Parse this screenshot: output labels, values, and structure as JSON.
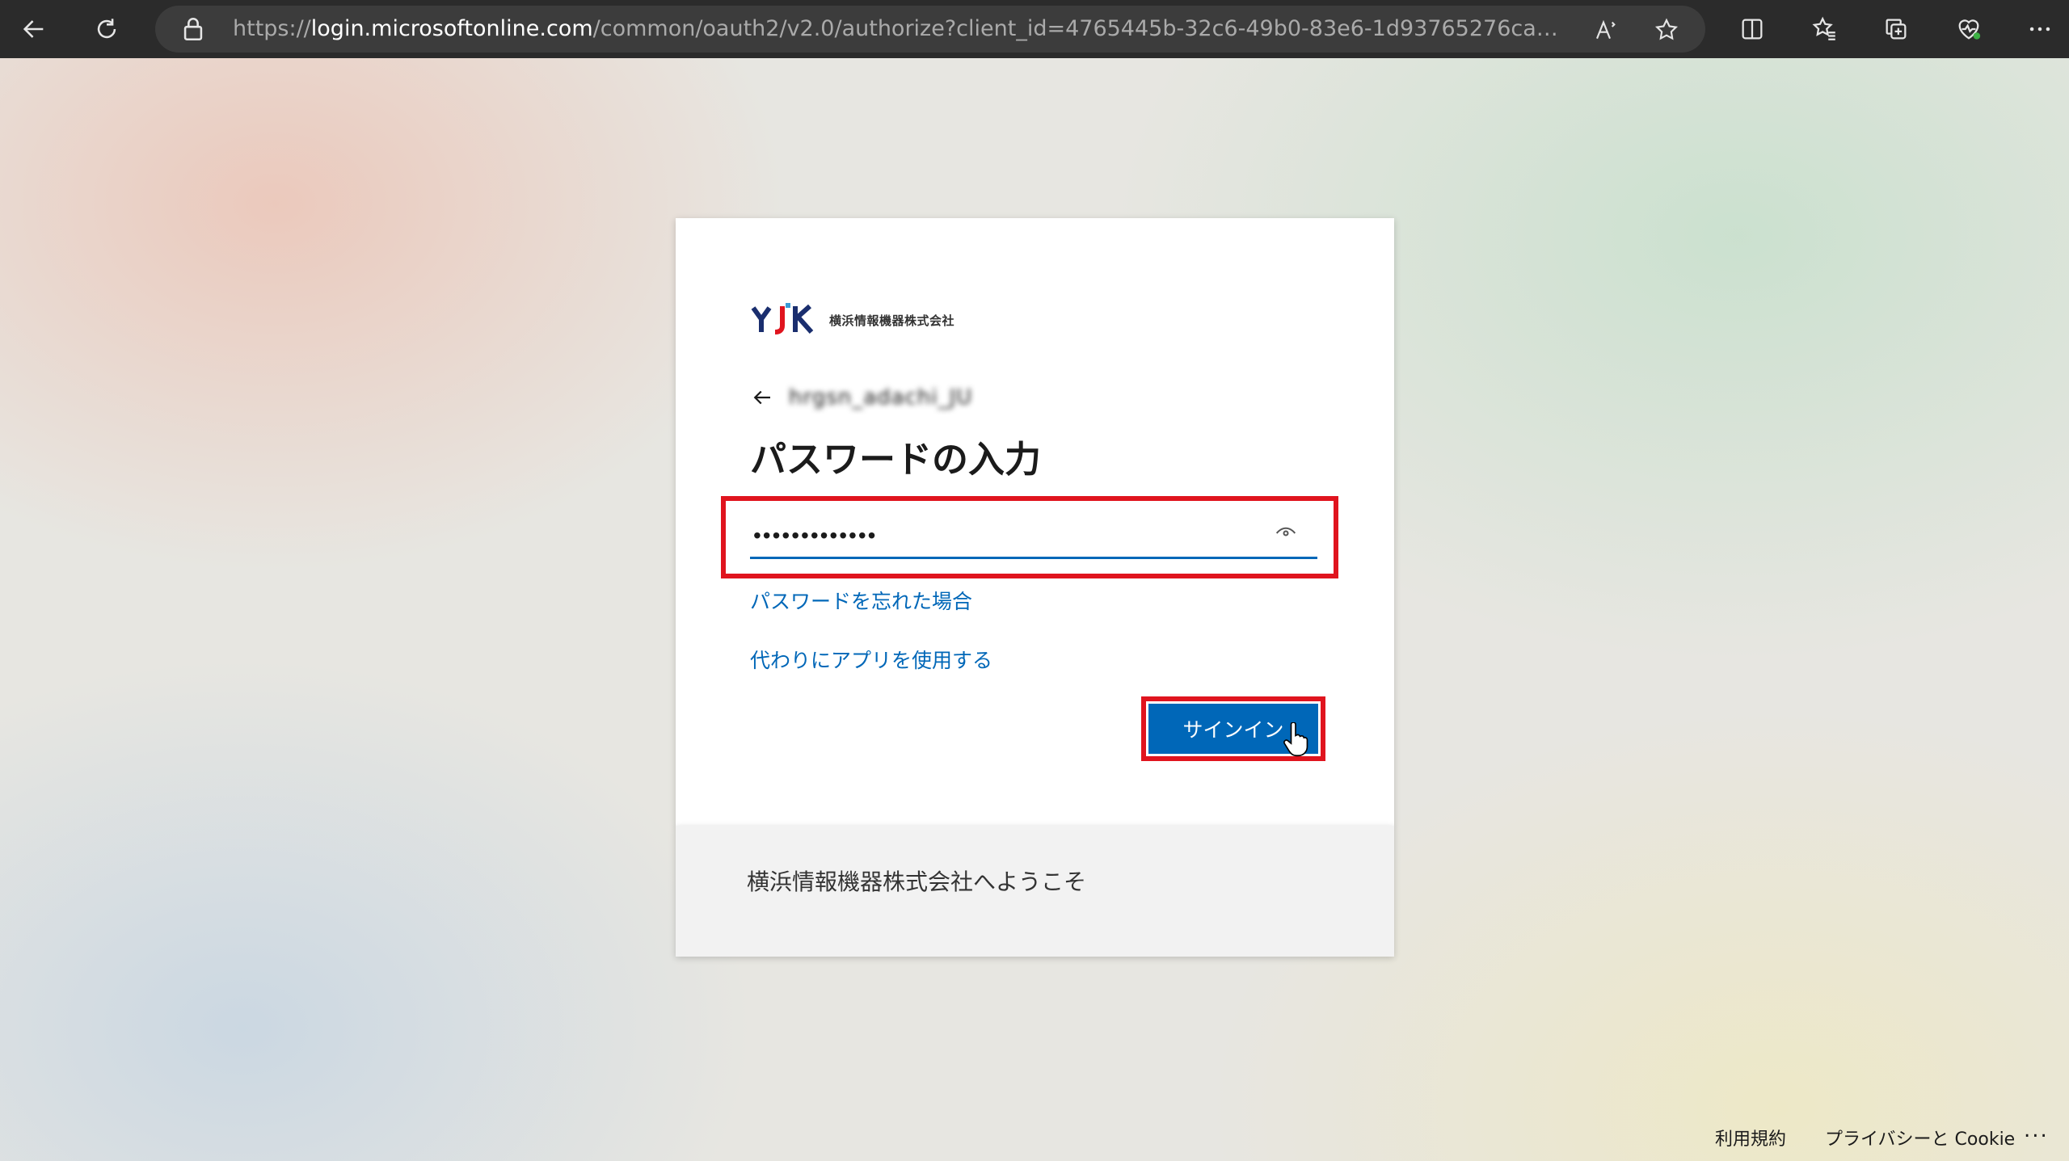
{
  "browser": {
    "url_prefix": "https://",
    "url_host": "login.microsoftonline.com",
    "url_rest": "/common/oauth2/v2.0/authorize?client_id=4765445b-32c6-49b0-83e6-1d93765276ca&redirect..."
  },
  "icons": {
    "back": "arrow-left-icon",
    "refresh": "refresh-icon",
    "lock": "lock-icon",
    "read_aloud": "read-aloud-icon",
    "favorite": "star-icon",
    "split": "split-screen-icon",
    "favorites": "favorites-icon",
    "collections": "collections-icon",
    "browser_essentials": "heart-pulse-icon",
    "menu": "more-horizontal-icon"
  },
  "card": {
    "company_name": "横浜情報機器株式会社",
    "account": "hrgsn_adachi_JU",
    "heading": "パスワードの入力",
    "password_value": "•••••••••••••",
    "forgot_link": "パスワードを忘れた場合",
    "use_app_link": "代わりにアプリを使用する",
    "signin_label": "サインイン",
    "welcome": "横浜情報機器株式会社へようこそ"
  },
  "footer": {
    "terms": "利用規約",
    "privacy": "プライバシーと Cookie",
    "more": "..."
  },
  "colors": {
    "accent": "#0067b8",
    "highlight": "#e0141e"
  }
}
